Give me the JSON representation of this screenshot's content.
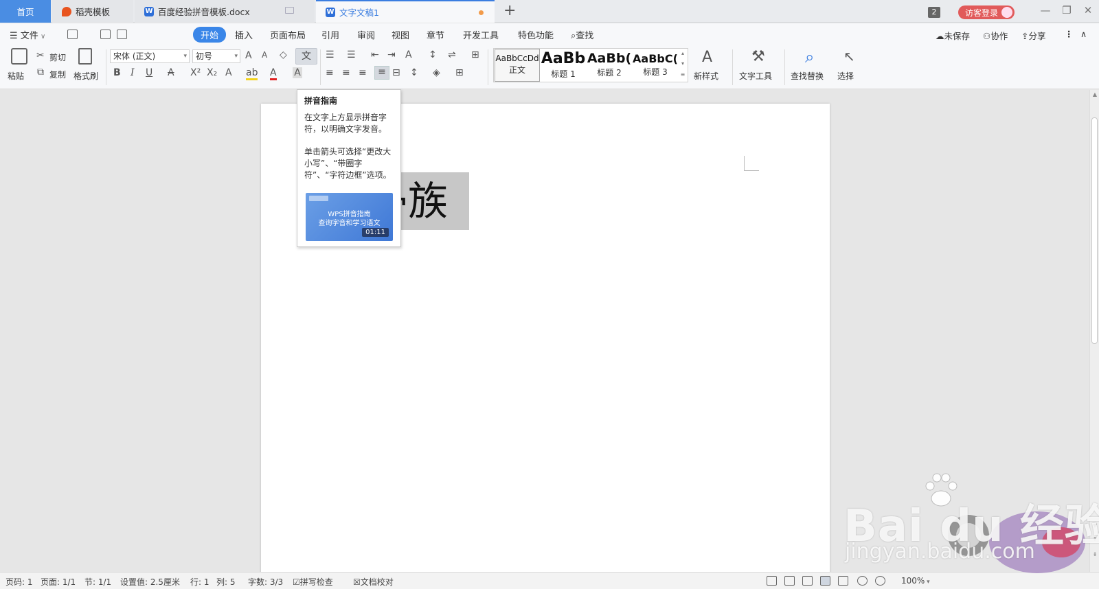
{
  "tabs": {
    "home": "首页",
    "daoke": "稻壳模板",
    "doc1": "百度经验拼音模板.docx",
    "doc2": "文字文稿1",
    "new_tab": "+"
  },
  "title_right": {
    "window_count": "2",
    "login": "访客登录",
    "minimize": "—",
    "restore": "❐",
    "close": "✕"
  },
  "menu": {
    "file": "文件",
    "items": [
      "开始",
      "插入",
      "页面布局",
      "引用",
      "审阅",
      "视图",
      "章节",
      "开发工具",
      "特色功能"
    ],
    "find": "查找",
    "unsaved": "未保存",
    "collab": "协作",
    "share": "分享"
  },
  "ribbon": {
    "paste": "粘贴",
    "cut": "剪切",
    "copy": "复制",
    "format_painter": "格式刷",
    "font_name": "宋体 (正文)",
    "font_size": "初号",
    "pinyin_glyph": "文",
    "styles": [
      {
        "preview": "AaBbCcDd",
        "name": "正文"
      },
      {
        "preview": "AaBb",
        "name": "标题 1"
      },
      {
        "preview": "AaBb(",
        "name": "标题 2"
      },
      {
        "preview": "AaBbC(",
        "name": "标题 3"
      }
    ],
    "new_style": "新样式",
    "text_tools": "文字工具",
    "find_replace": "查找替换",
    "select": "选择"
  },
  "tooltip": {
    "title": "拼音指南",
    "desc1": "在文字上方显示拼音字符，以明确文字发音。",
    "desc2": "单击箭头可选择“更改大小写”、“带圈字符”、“字符边框”选项。",
    "video_title1": "WPS拼音指南",
    "video_title2": "查询字音和学习语文",
    "video_duration": "01:11"
  },
  "document": {
    "visible_text": "帚族"
  },
  "status": {
    "page_num": "页码: 1",
    "page_count": "页面: 1/1",
    "section": "节: 1/1",
    "setting": "设置值: 2.5厘米",
    "row": "行: 1",
    "col": "列: 5",
    "word_count": "字数: 3/3",
    "spell_check": "拼写检查",
    "proofread": "文档校对",
    "zoom": "100%"
  },
  "watermark": {
    "brand": "Bai du 经验",
    "url": "jingyan.baidu.com"
  },
  "colors": {
    "accent": "#3a86e8",
    "home_tab": "#4a8de3",
    "login_btn": "#e15a5a",
    "unsaved_dot": "#f29b4a",
    "selection": "#c7c7c7"
  }
}
